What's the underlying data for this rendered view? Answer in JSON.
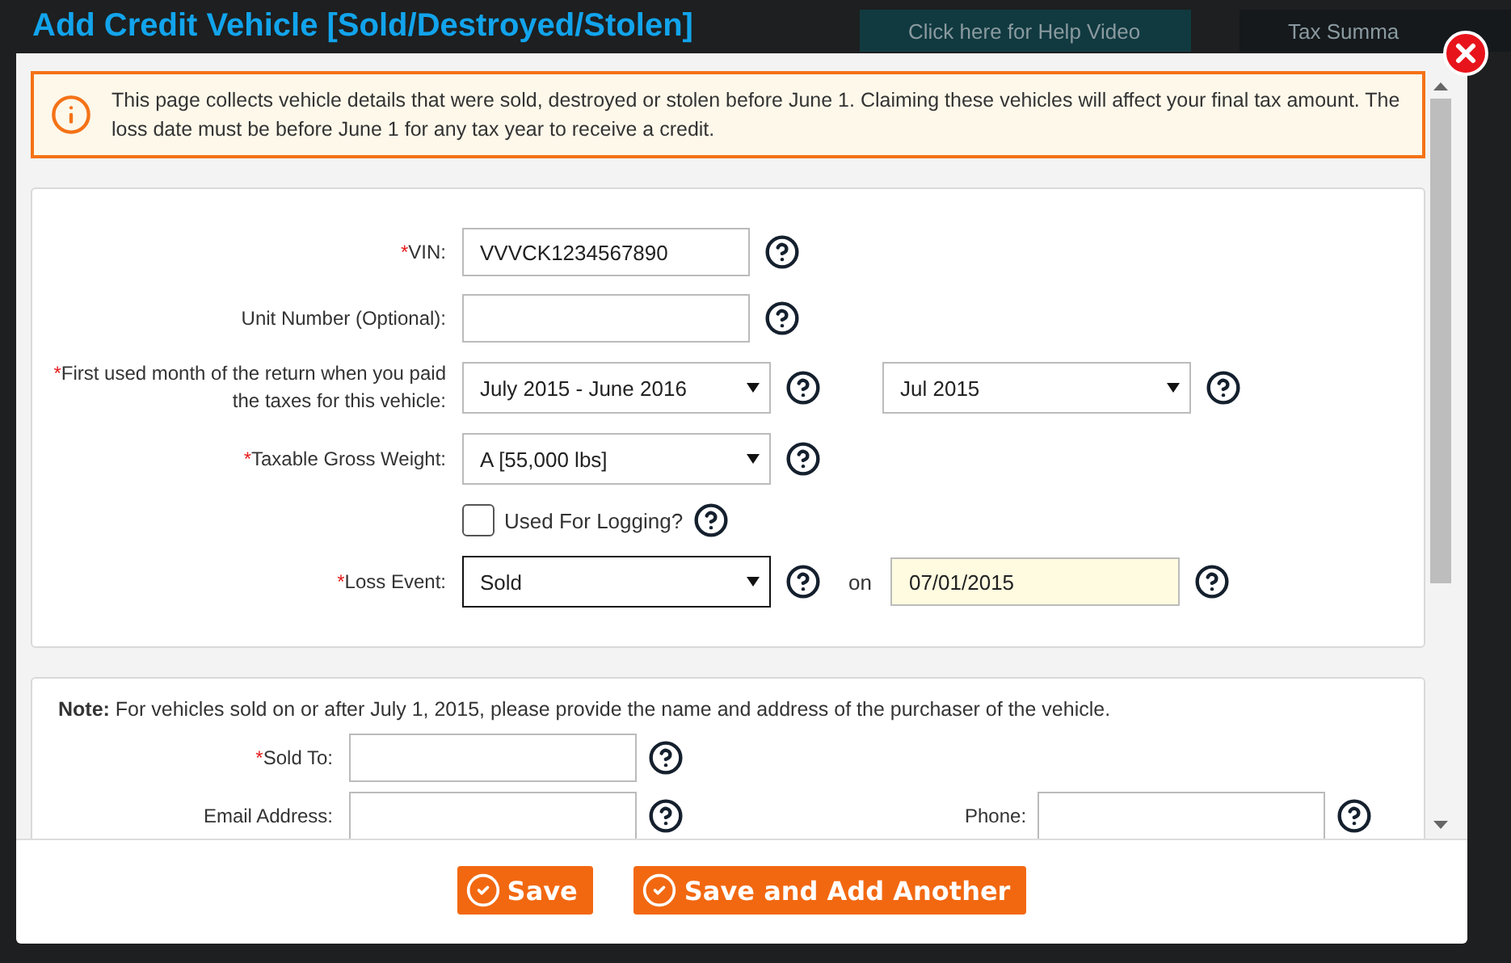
{
  "backdrop": {
    "help_video": "Click here for Help Video",
    "tax_summary": "Tax Summa"
  },
  "title": "Add Credit Vehicle [Sold/Destroyed/Stolen]",
  "info": "This page collects vehicle details that were sold, destroyed or stolen before June 1. Claiming these vehicles will affect your final tax amount. The loss date must be before June 1 for any tax year to receive a credit.",
  "fields": [
    {
      "kind": "text",
      "required_mark": "*",
      "label": "VIN:",
      "value": "VVVCK1234567890"
    },
    {
      "kind": "text",
      "label": "Unit Number (Optional):"
    },
    {
      "kind": "select_pair",
      "required_mark": "*",
      "label": "First used month of the return when you paid the taxes for this vehicle:",
      "value": "July 2015 - June 2016",
      "value_2": "Jul 2015"
    },
    {
      "kind": "select",
      "required_mark": "*",
      "label": "Taxable Gross Weight:",
      "value": "A [55,000 lbs]"
    },
    {
      "kind": "checkbox",
      "label": "Used For Logging?",
      "checked": false
    },
    {
      "kind": "select_date",
      "required_mark": "*",
      "label": "Loss Event:",
      "value": "Sold",
      "focused": true,
      "connector": "on",
      "date": "07/01/2015"
    }
  ],
  "note": "**Note:** For vehicles sold on or after July 1, 2015, please provide the name and address of the purchaser of the vehicle.",
  "purchaser": {
    "sold_to": {
      "required_mark": "*",
      "label": "Sold To:"
    },
    "email": {
      "label": "Email Address:"
    },
    "phone": {
      "label": "Phone:"
    }
  },
  "buttons": [
    {
      "label": "Save"
    },
    {
      "label": "Save and Add Another"
    }
  ]
}
